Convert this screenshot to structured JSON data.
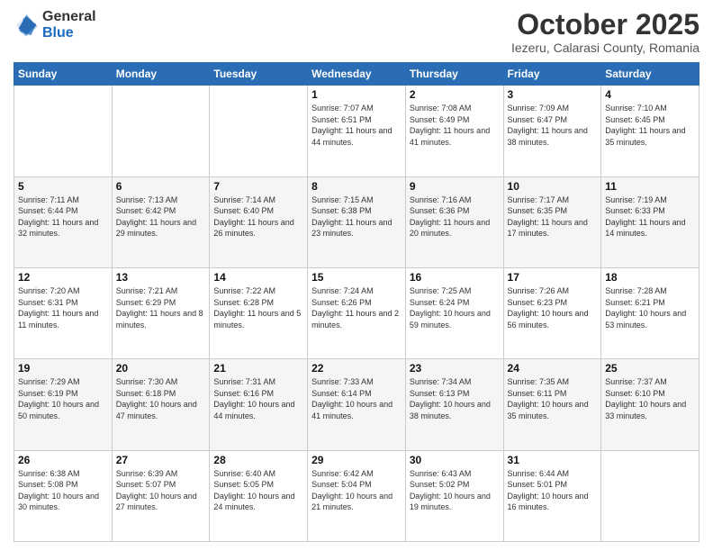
{
  "logo": {
    "general": "General",
    "blue": "Blue"
  },
  "title": "October 2025",
  "location": "Iezeru, Calarasi County, Romania",
  "days_of_week": [
    "Sunday",
    "Monday",
    "Tuesday",
    "Wednesday",
    "Thursday",
    "Friday",
    "Saturday"
  ],
  "weeks": [
    [
      {
        "day": "",
        "info": ""
      },
      {
        "day": "",
        "info": ""
      },
      {
        "day": "",
        "info": ""
      },
      {
        "day": "1",
        "info": "Sunrise: 7:07 AM\nSunset: 6:51 PM\nDaylight: 11 hours\nand 44 minutes."
      },
      {
        "day": "2",
        "info": "Sunrise: 7:08 AM\nSunset: 6:49 PM\nDaylight: 11 hours\nand 41 minutes."
      },
      {
        "day": "3",
        "info": "Sunrise: 7:09 AM\nSunset: 6:47 PM\nDaylight: 11 hours\nand 38 minutes."
      },
      {
        "day": "4",
        "info": "Sunrise: 7:10 AM\nSunset: 6:45 PM\nDaylight: 11 hours\nand 35 minutes."
      }
    ],
    [
      {
        "day": "5",
        "info": "Sunrise: 7:11 AM\nSunset: 6:44 PM\nDaylight: 11 hours\nand 32 minutes."
      },
      {
        "day": "6",
        "info": "Sunrise: 7:13 AM\nSunset: 6:42 PM\nDaylight: 11 hours\nand 29 minutes."
      },
      {
        "day": "7",
        "info": "Sunrise: 7:14 AM\nSunset: 6:40 PM\nDaylight: 11 hours\nand 26 minutes."
      },
      {
        "day": "8",
        "info": "Sunrise: 7:15 AM\nSunset: 6:38 PM\nDaylight: 11 hours\nand 23 minutes."
      },
      {
        "day": "9",
        "info": "Sunrise: 7:16 AM\nSunset: 6:36 PM\nDaylight: 11 hours\nand 20 minutes."
      },
      {
        "day": "10",
        "info": "Sunrise: 7:17 AM\nSunset: 6:35 PM\nDaylight: 11 hours\nand 17 minutes."
      },
      {
        "day": "11",
        "info": "Sunrise: 7:19 AM\nSunset: 6:33 PM\nDaylight: 11 hours\nand 14 minutes."
      }
    ],
    [
      {
        "day": "12",
        "info": "Sunrise: 7:20 AM\nSunset: 6:31 PM\nDaylight: 11 hours\nand 11 minutes."
      },
      {
        "day": "13",
        "info": "Sunrise: 7:21 AM\nSunset: 6:29 PM\nDaylight: 11 hours\nand 8 minutes."
      },
      {
        "day": "14",
        "info": "Sunrise: 7:22 AM\nSunset: 6:28 PM\nDaylight: 11 hours\nand 5 minutes."
      },
      {
        "day": "15",
        "info": "Sunrise: 7:24 AM\nSunset: 6:26 PM\nDaylight: 11 hours\nand 2 minutes."
      },
      {
        "day": "16",
        "info": "Sunrise: 7:25 AM\nSunset: 6:24 PM\nDaylight: 10 hours\nand 59 minutes."
      },
      {
        "day": "17",
        "info": "Sunrise: 7:26 AM\nSunset: 6:23 PM\nDaylight: 10 hours\nand 56 minutes."
      },
      {
        "day": "18",
        "info": "Sunrise: 7:28 AM\nSunset: 6:21 PM\nDaylight: 10 hours\nand 53 minutes."
      }
    ],
    [
      {
        "day": "19",
        "info": "Sunrise: 7:29 AM\nSunset: 6:19 PM\nDaylight: 10 hours\nand 50 minutes."
      },
      {
        "day": "20",
        "info": "Sunrise: 7:30 AM\nSunset: 6:18 PM\nDaylight: 10 hours\nand 47 minutes."
      },
      {
        "day": "21",
        "info": "Sunrise: 7:31 AM\nSunset: 6:16 PM\nDaylight: 10 hours\nand 44 minutes."
      },
      {
        "day": "22",
        "info": "Sunrise: 7:33 AM\nSunset: 6:14 PM\nDaylight: 10 hours\nand 41 minutes."
      },
      {
        "day": "23",
        "info": "Sunrise: 7:34 AM\nSunset: 6:13 PM\nDaylight: 10 hours\nand 38 minutes."
      },
      {
        "day": "24",
        "info": "Sunrise: 7:35 AM\nSunset: 6:11 PM\nDaylight: 10 hours\nand 35 minutes."
      },
      {
        "day": "25",
        "info": "Sunrise: 7:37 AM\nSunset: 6:10 PM\nDaylight: 10 hours\nand 33 minutes."
      }
    ],
    [
      {
        "day": "26",
        "info": "Sunrise: 6:38 AM\nSunset: 5:08 PM\nDaylight: 10 hours\nand 30 minutes."
      },
      {
        "day": "27",
        "info": "Sunrise: 6:39 AM\nSunset: 5:07 PM\nDaylight: 10 hours\nand 27 minutes."
      },
      {
        "day": "28",
        "info": "Sunrise: 6:40 AM\nSunset: 5:05 PM\nDaylight: 10 hours\nand 24 minutes."
      },
      {
        "day": "29",
        "info": "Sunrise: 6:42 AM\nSunset: 5:04 PM\nDaylight: 10 hours\nand 21 minutes."
      },
      {
        "day": "30",
        "info": "Sunrise: 6:43 AM\nSunset: 5:02 PM\nDaylight: 10 hours\nand 19 minutes."
      },
      {
        "day": "31",
        "info": "Sunrise: 6:44 AM\nSunset: 5:01 PM\nDaylight: 10 hours\nand 16 minutes."
      },
      {
        "day": "",
        "info": ""
      }
    ]
  ]
}
